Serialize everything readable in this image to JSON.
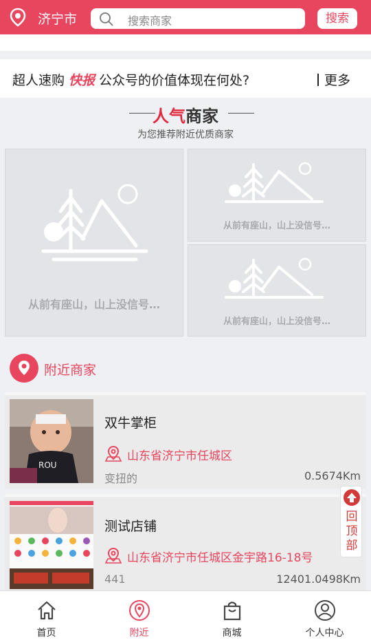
{
  "header": {
    "city": "济宁市",
    "search_placeholder": "搜索商家",
    "search_button": "搜索"
  },
  "news": {
    "prefix": "超人速购",
    "badge": "快报",
    "headline": "公众号的价值体现在何处?",
    "more": "更多"
  },
  "popular": {
    "title_highlight": "人气",
    "title_rest": "商家",
    "subtitle": "为您推荐附近优质商家",
    "tiles": [
      {
        "caption": "从前有座山，山上没信号…"
      },
      {
        "caption": "从前有座山，山上没信号…"
      },
      {
        "caption": "从前有座山，山上没信号…"
      }
    ]
  },
  "nearby": {
    "title": "附近商家",
    "shops": [
      {
        "name": "双牛掌柜",
        "address": "山东省济宁市任城区",
        "desc": "变扭的",
        "distance": "0.5674Km"
      },
      {
        "name": "测试店铺",
        "address": "山东省济宁市任城区金宇路16-18号",
        "desc": "441",
        "distance": "12401.0498Km"
      }
    ]
  },
  "back_to_top": "回顶部",
  "bottom_nav": [
    {
      "label": "首页",
      "icon": "home-icon"
    },
    {
      "label": "附近",
      "icon": "location-icon"
    },
    {
      "label": "商城",
      "icon": "shopping-bag-icon"
    },
    {
      "label": "个人中心",
      "icon": "user-icon"
    }
  ],
  "colors": {
    "brand": "#e8455e",
    "placeholder_gray": "#a9aab0"
  }
}
